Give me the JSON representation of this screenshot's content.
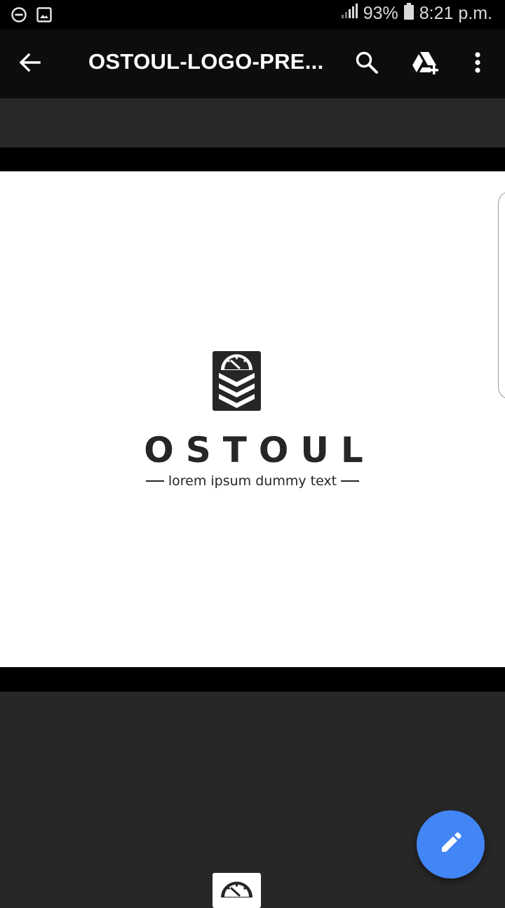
{
  "status_bar": {
    "left_icons": [
      "do-not-disturb-icon",
      "image-icon"
    ],
    "signal_icon": "signal-icon",
    "battery_percent": "93%",
    "battery_icon": "battery-icon",
    "time": "8:21 p.m."
  },
  "app_bar": {
    "back_icon": "arrow-back-icon",
    "title": "OSTOUL-LOGO-PRE...",
    "search_icon": "search-icon",
    "drive_icon": "drive-add-icon",
    "more_icon": "more-vert-icon"
  },
  "document": {
    "logo_icon": "ostoul-logo-icon",
    "brand": "OSTOUL",
    "tagline": "lorem ipsum dummy text"
  },
  "fab": {
    "icon": "edit-pencil-icon",
    "color": "#4285f4"
  },
  "colors": {
    "app_bar": "#0d0d0d",
    "viewer_bg": "#272727",
    "fab": "#4285f4",
    "logo_dark": "#262626"
  }
}
